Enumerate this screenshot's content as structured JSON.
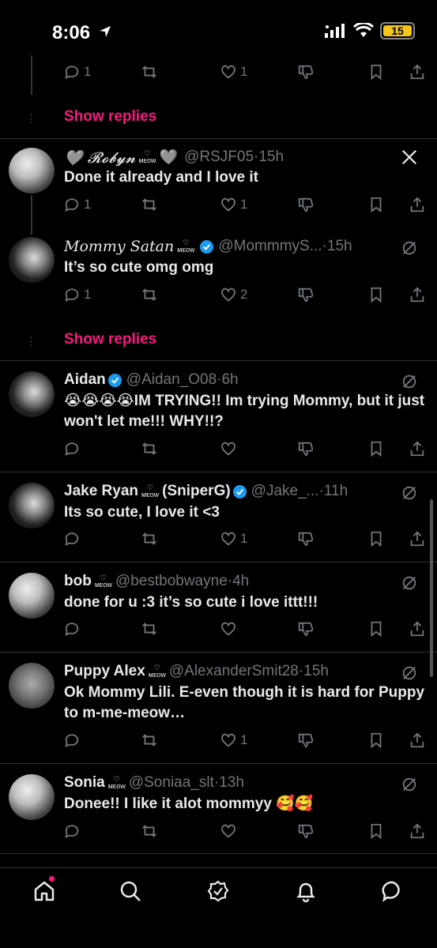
{
  "status": {
    "time": "8:06",
    "battery": "15"
  },
  "top_actions": {
    "reply": "1",
    "like": "1"
  },
  "show_replies_1": "Show replies",
  "show_replies_2": "Show replies",
  "tweets": [
    {
      "name": "🩶 𝓡𝓸𝓫𝔂𝓷",
      "suffix": "🩶",
      "handle": "@RSJF05",
      "time": "15h",
      "text": "Done it already and I love it",
      "reply": "1",
      "like": "1"
    },
    {
      "name": "𝑀𝑜𝑚𝑚𝑦 𝑆𝑎𝑡𝑎𝑛",
      "handle": "@MommmyS...",
      "time": "15h",
      "text": "It’s so cute omg omg",
      "reply": "1",
      "like": "2"
    },
    {
      "name": "Aidan",
      "handle": "@Aidan_O08",
      "time": "6h",
      "text": "😭😭😭😭IM TRYING!! Im trying Mommy, but it just won't let me!!! WHY!!?",
      "reply": "",
      "like": ""
    },
    {
      "name": "Jake Ryan",
      "name2": "(SniperG)",
      "handle": "@Jake_...",
      "time": "11h",
      "text": "Its so cute, I love it <3",
      "reply": "",
      "like": "1"
    },
    {
      "name": "bob",
      "handle": "@bestbobwayne",
      "time": "4h",
      "text": "done for u :3 it’s so cute i love ittt!!!",
      "reply": "",
      "like": ""
    },
    {
      "name": "Puppy Alex",
      "handle": "@AlexanderSmit28",
      "time": "15h",
      "text": "Ok Mommy Lili. E-even though it is hard for Puppy to m-me-meow…",
      "reply": "",
      "like": "1"
    },
    {
      "name": "Sonia",
      "handle": "@Soniaa_slt",
      "time": "13h",
      "text": "Donee!! I like it alot mommyy 🥰🥰",
      "reply": "",
      "like": ""
    }
  ],
  "meow_label": "ᴍᴇᴏᴡ",
  "dot_sep": "·",
  "colors": {
    "accent": "#f91880",
    "verified": "#1d9bf0",
    "muted": "#71767b"
  }
}
